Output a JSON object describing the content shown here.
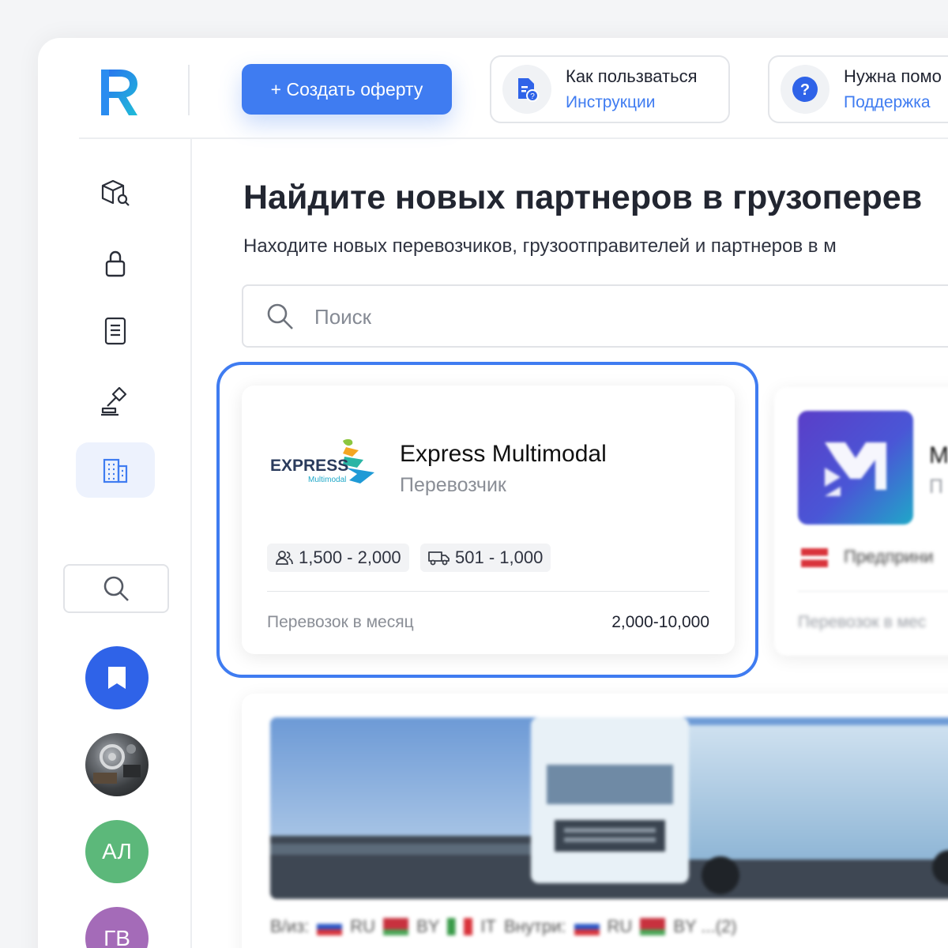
{
  "header": {
    "create_button": "+ Создать оферту",
    "help_how": {
      "title": "Как пользваться",
      "link": "Инструкции"
    },
    "help_support": {
      "title": "Нужна помо",
      "link": "Поддержка"
    }
  },
  "sidebar": {
    "items": [
      {
        "icon": "package-search-icon",
        "active": false
      },
      {
        "icon": "lock-icon",
        "active": false
      },
      {
        "icon": "document-list-icon",
        "active": false
      },
      {
        "icon": "gavel-icon",
        "active": false
      },
      {
        "icon": "building-icon",
        "active": true
      }
    ],
    "avatars": [
      {
        "type": "bookmark",
        "color": "#2f63e8"
      },
      {
        "type": "photo"
      },
      {
        "initials": "АЛ",
        "color": "#5cb87a"
      },
      {
        "initials": "ГВ",
        "color": "#a46bb8"
      }
    ]
  },
  "main": {
    "title": "Найдите новых партнеров в грузоперев",
    "subtitle": "Находите новых перевозчиков, грузоотправителей и партнеров в м",
    "search_placeholder": "Поиск",
    "partner_card": {
      "logo_text": "EXPRESS",
      "logo_subtext": "Multimodal",
      "name": "Express Multimodal",
      "type": "Перевозчик",
      "employees": "1,500 - 2,000",
      "trucks": "501 - 1,000",
      "footer_label": "Перевозок в месяц",
      "footer_value": "2,000-10,000"
    },
    "partner_card_2": {
      "name": "М",
      "type": "П",
      "tag": "Предприни",
      "footer_label": "Перевозок в мес"
    },
    "partner_card_3": {
      "routes_label_1": "В/из:",
      "route_1": "RU",
      "route_2": "BY",
      "route_3": "IT",
      "routes_label_2": "Внутри:",
      "route_4": "RU",
      "route_5": "BY ...(2)"
    }
  },
  "colors": {
    "accent": "#3f7cf1",
    "logo_blue": "#2a8cf0",
    "logo_teal": "#1fbcd8"
  }
}
